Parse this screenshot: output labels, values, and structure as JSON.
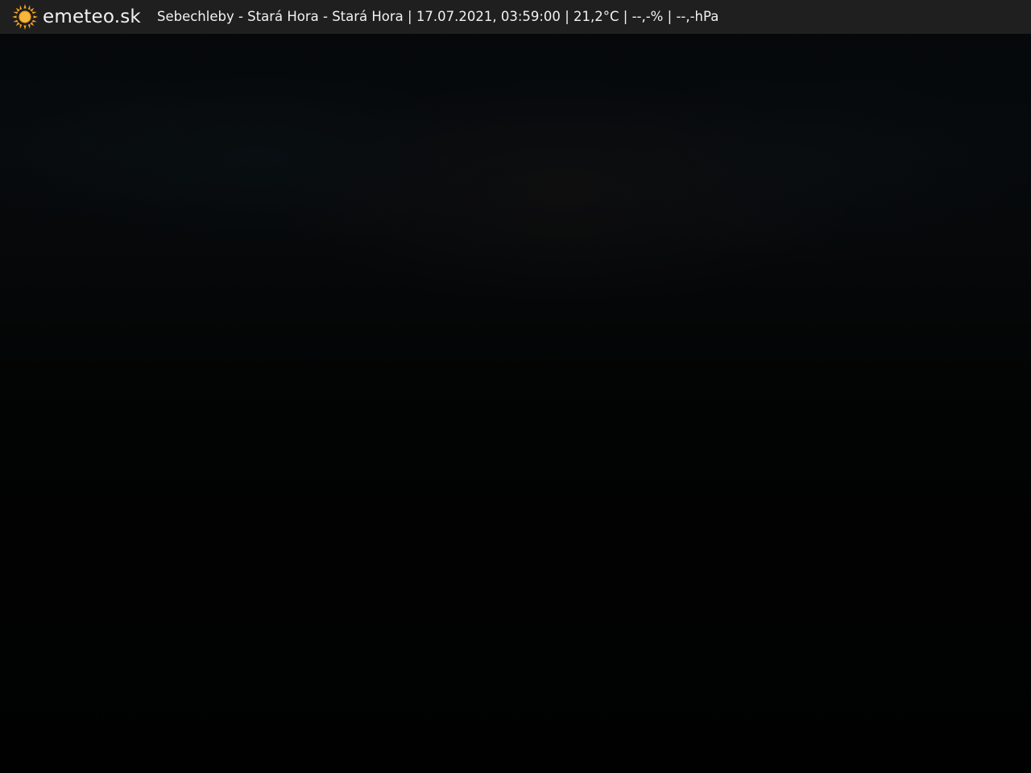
{
  "overlay": {
    "brand": {
      "icon": "sun-icon",
      "name": "emeteo.sk",
      "icon_color": "#f5a623"
    },
    "info": {
      "station": "Sebechleby - Stará Hora - Stará Hora",
      "separator": "|",
      "datetime": "17.07.2021, 03:59:00",
      "temperature": "21,2°C",
      "humidity": "--,-%",
      "pressure": "--,-hPa"
    }
  },
  "colors": {
    "bar_background": "#1f1f1f",
    "text": "#f2f2f2",
    "scene": "#000000"
  }
}
